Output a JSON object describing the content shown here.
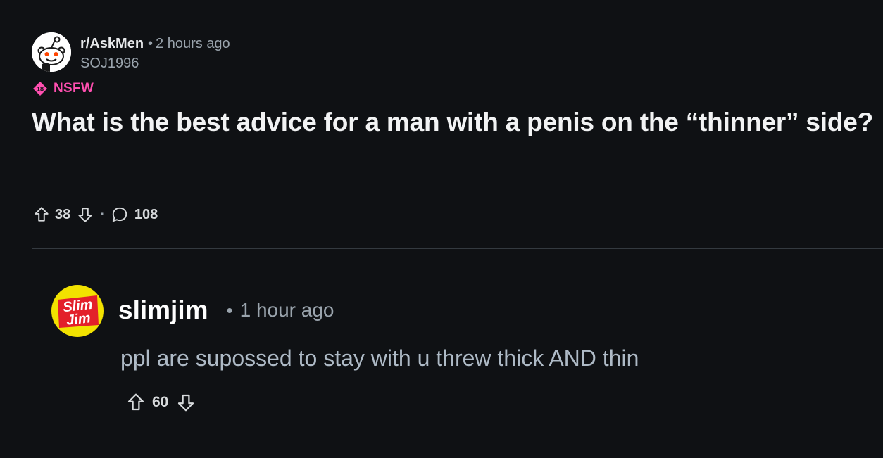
{
  "post": {
    "subreddit": "r/AskMen",
    "time": "2 hours ago",
    "author": "SOJ1996",
    "nsfw_badge": "18",
    "nsfw_label": "NSFW",
    "title": "What is the best advice for a man with a penis on the “thinner” side?",
    "score": "38",
    "comments": "108",
    "separator": "·"
  },
  "comment": {
    "username": "slimjim",
    "avatar_text_1": "Slim",
    "avatar_text_2": "Jim",
    "time": "1 hour ago",
    "separator": "•",
    "body": "ppl are supossed to stay with u threw thick AND thin",
    "score": "60"
  },
  "icons": {
    "subreddit_avatar": "snoo-icon",
    "nsfw": "nsfw-badge-icon",
    "upvote": "arrow-up-icon",
    "downvote": "arrow-down-icon",
    "comment": "speech-bubble-icon",
    "comment_avatar": "slim-jim-logo"
  },
  "colors": {
    "background": "#0f1114",
    "nsfw": "#ff4fb0",
    "muted": "#9aa4ad",
    "comment_text": "#aebac6"
  }
}
